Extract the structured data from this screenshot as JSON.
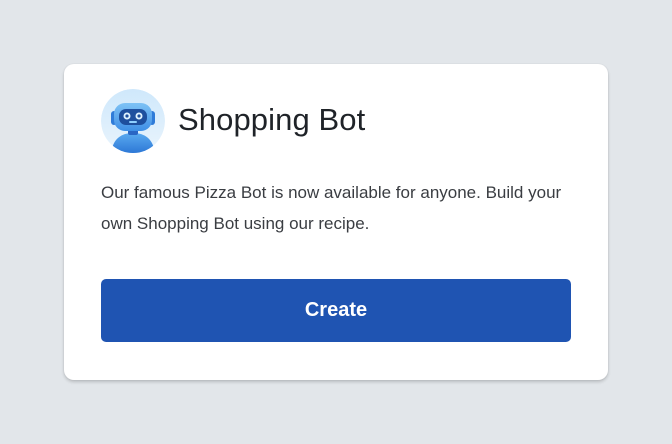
{
  "card": {
    "title": "Shopping Bot",
    "description": "Our famous Pizza Bot is now available for anyone. Build your own Shopping Bot using our recipe.",
    "avatar_icon": "robot-avatar-icon",
    "create_label": "Create"
  },
  "colors": {
    "page_background": "#e2e6ea",
    "card_background": "#ffffff",
    "button_primary": "#1f54b2",
    "title_text": "#1f2328",
    "body_text": "#3a3d42"
  }
}
